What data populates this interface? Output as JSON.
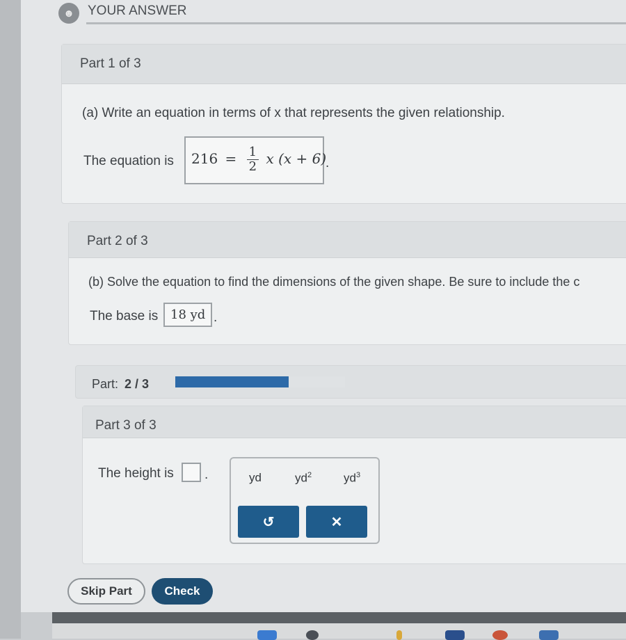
{
  "answer_header": {
    "icon": "person-icon",
    "title": "YOUR ANSWER"
  },
  "part1": {
    "header": "Part 1 of 3",
    "question": "(a) Write an equation in terms of x that represents the given relationship.",
    "prompt": "The equation is",
    "equation": {
      "lhs": "216",
      "equals": "=",
      "frac_num": "1",
      "frac_den": "2",
      "rhs": "x (x + 6)"
    },
    "trailing": "."
  },
  "part2": {
    "header": "Part 2 of 3",
    "question": "(b) Solve the equation to find the dimensions of the given shape. Be sure to include the c",
    "prompt": "The base is",
    "answer": "18 yd",
    "trailing": "."
  },
  "progress": {
    "label": "Part:",
    "value": "2 / 3",
    "fraction": 0.667
  },
  "part3": {
    "header": "Part 3 of 3",
    "prompt": "The height is",
    "trailing": "."
  },
  "palette": {
    "units": [
      "yd",
      "yd",
      "yd"
    ],
    "unit_exponents": [
      "",
      "2",
      "3"
    ],
    "reset_icon": "undo-icon",
    "clear_icon": "close-icon",
    "reset_glyph": "↺",
    "clear_glyph": "✕"
  },
  "actions": {
    "skip": "Skip Part",
    "check": "Check"
  },
  "colors": {
    "progress": "#2d6aa8",
    "check_button": "#1e4e73",
    "palette_button": "#1f5c8c"
  }
}
